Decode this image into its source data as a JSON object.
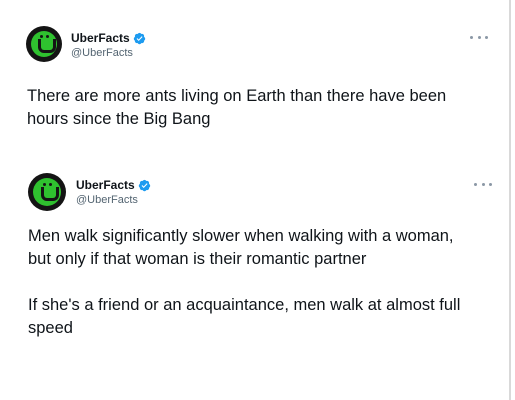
{
  "tweets": [
    {
      "display_name": "UberFacts",
      "handle": "@UberFacts",
      "verified": true,
      "avatar_icon": "uberfacts-logo",
      "more_icon": "more-options-icon",
      "text": "There are more ants living on Earth than there have been hours since the Big Bang"
    },
    {
      "display_name": "UberFacts",
      "handle": "@UberFacts",
      "verified": true,
      "avatar_icon": "uberfacts-logo",
      "more_icon": "more-options-icon",
      "text": "Men walk significantly slower when walking with a woman, but only if that woman is their romantic partner\n\nIf she's a friend or an acquaintance, men walk at almost full speed"
    }
  ],
  "colors": {
    "verified_blue": "#1d9bf0",
    "avatar_green": "#2fc12f",
    "text_primary": "#0f1419",
    "text_secondary": "#536471"
  }
}
